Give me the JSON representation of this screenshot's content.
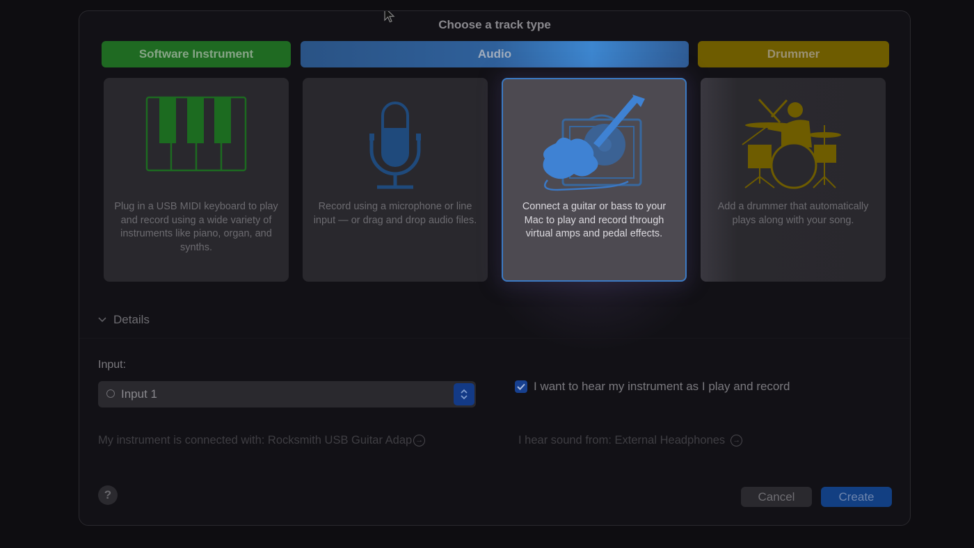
{
  "dialog": {
    "title": "Choose a track type"
  },
  "categories": [
    {
      "label": "Software Instrument",
      "color": "#1f6a22"
    },
    {
      "label": "Audio",
      "color": "#2f609a"
    },
    {
      "label": "Drummer",
      "color": "#6e5c00"
    }
  ],
  "track_types": [
    {
      "icon": "piano-keyboard-icon",
      "description": "Plug in a USB MIDI keyboard to play and record using a wide variety of instruments like piano, organ, and synths.",
      "selected": false
    },
    {
      "icon": "microphone-icon",
      "description": "Record using a microphone or line input — or drag and drop audio files.",
      "selected": false
    },
    {
      "icon": "guitar-amp-icon",
      "description": "Connect a guitar or bass to your Mac to play and record through virtual amps and pedal effects.",
      "selected": true
    },
    {
      "icon": "drummer-icon",
      "description": "Add a drummer that automatically plays along with your song.",
      "selected": false
    }
  ],
  "details": {
    "toggle_label": "Details",
    "input_label": "Input:",
    "input_value": "Input 1",
    "monitor_checkbox_label": "I want to hear my instrument as I play and record",
    "monitor_checked": true,
    "instrument_connection": "My instrument is connected with: Rocksmith USB Guitar Adap",
    "output_source": "I hear sound from: External Headphones"
  },
  "footer": {
    "help_label": "?",
    "cancel_label": "Cancel",
    "create_label": "Create"
  },
  "colors": {
    "accent": "#3b7ac4",
    "create_button": "#123f82"
  }
}
